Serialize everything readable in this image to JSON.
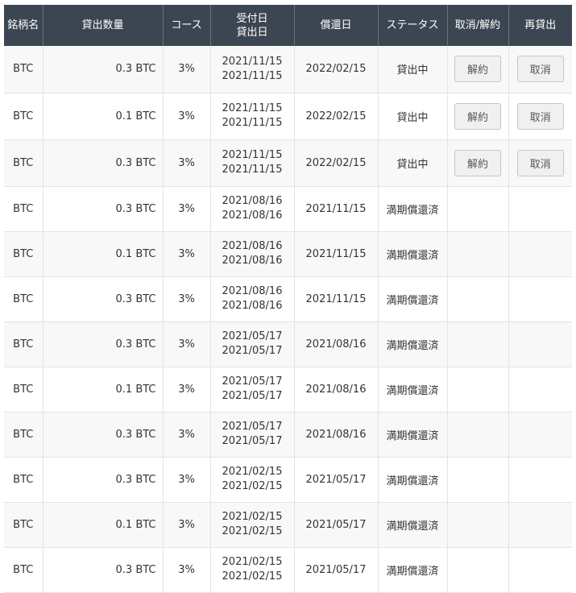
{
  "table": {
    "headers": {
      "name": "銘柄名",
      "amount": "貸出数量",
      "course": "コース",
      "received": "受付日",
      "lent": "貸出日",
      "repay": "償還日",
      "status": "ステータス",
      "cancel": "取消/解約",
      "relend": "再貸出"
    },
    "rows": [
      {
        "name": "BTC",
        "amount": "0.3 BTC",
        "course": "3%",
        "received": "2021/11/15",
        "lent": "2021/11/15",
        "repay": "2022/02/15",
        "status": "貸出中",
        "cancel_label": "解約",
        "relend_label": "取消"
      },
      {
        "name": "BTC",
        "amount": "0.1 BTC",
        "course": "3%",
        "received": "2021/11/15",
        "lent": "2021/11/15",
        "repay": "2022/02/15",
        "status": "貸出中",
        "cancel_label": "解約",
        "relend_label": "取消"
      },
      {
        "name": "BTC",
        "amount": "0.3 BTC",
        "course": "3%",
        "received": "2021/11/15",
        "lent": "2021/11/15",
        "repay": "2022/02/15",
        "status": "貸出中",
        "cancel_label": "解約",
        "relend_label": "取消"
      },
      {
        "name": "BTC",
        "amount": "0.3 BTC",
        "course": "3%",
        "received": "2021/08/16",
        "lent": "2021/08/16",
        "repay": "2021/11/15",
        "status": "満期償還済"
      },
      {
        "name": "BTC",
        "amount": "0.1 BTC",
        "course": "3%",
        "received": "2021/08/16",
        "lent": "2021/08/16",
        "repay": "2021/11/15",
        "status": "満期償還済"
      },
      {
        "name": "BTC",
        "amount": "0.3 BTC",
        "course": "3%",
        "received": "2021/08/16",
        "lent": "2021/08/16",
        "repay": "2021/11/15",
        "status": "満期償還済"
      },
      {
        "name": "BTC",
        "amount": "0.3 BTC",
        "course": "3%",
        "received": "2021/05/17",
        "lent": "2021/05/17",
        "repay": "2021/08/16",
        "status": "満期償還済"
      },
      {
        "name": "BTC",
        "amount": "0.1 BTC",
        "course": "3%",
        "received": "2021/05/17",
        "lent": "2021/05/17",
        "repay": "2021/08/16",
        "status": "満期償還済"
      },
      {
        "name": "BTC",
        "amount": "0.3 BTC",
        "course": "3%",
        "received": "2021/05/17",
        "lent": "2021/05/17",
        "repay": "2021/08/16",
        "status": "満期償還済"
      },
      {
        "name": "BTC",
        "amount": "0.3 BTC",
        "course": "3%",
        "received": "2021/02/15",
        "lent": "2021/02/15",
        "repay": "2021/05/17",
        "status": "満期償還済"
      },
      {
        "name": "BTC",
        "amount": "0.1 BTC",
        "course": "3%",
        "received": "2021/02/15",
        "lent": "2021/02/15",
        "repay": "2021/05/17",
        "status": "満期償還済"
      },
      {
        "name": "BTC",
        "amount": "0.3 BTC",
        "course": "3%",
        "received": "2021/02/15",
        "lent": "2021/02/15",
        "repay": "2021/05/17",
        "status": "満期償還済"
      }
    ]
  }
}
